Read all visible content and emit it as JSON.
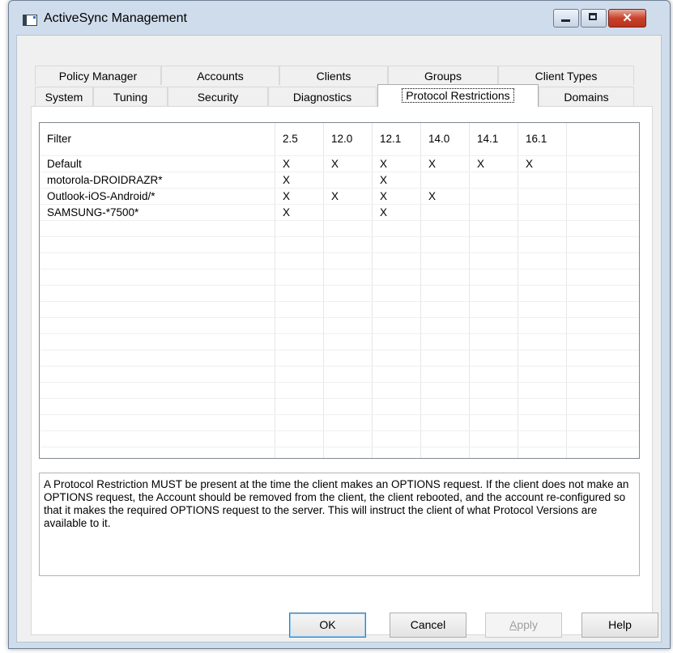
{
  "window": {
    "title": "ActiveSync Management"
  },
  "tabs": {
    "row_back": [
      "Policy Manager",
      "Accounts",
      "Clients",
      "Groups",
      "Client Types"
    ],
    "row_front": [
      "System",
      "Tuning",
      "Security",
      "Diagnostics",
      "Protocol Restrictions",
      "Domains"
    ],
    "active": "Protocol Restrictions"
  },
  "table": {
    "columns": [
      "Filter",
      "2.5",
      "12.0",
      "12.1",
      "14.0",
      "14.1",
      "16.1"
    ],
    "rows": [
      {
        "filter": "Default",
        "c25": "X",
        "c120": "X",
        "c121": "X",
        "c140": "X",
        "c141": "X",
        "c161": "X"
      },
      {
        "filter": "motorola-DROIDRAZR*",
        "c25": "X",
        "c120": "",
        "c121": "X",
        "c140": "",
        "c141": "",
        "c161": ""
      },
      {
        "filter": "Outlook-iOS-Android/*",
        "c25": "X",
        "c120": "X",
        "c121": "X",
        "c140": "X",
        "c141": "",
        "c161": ""
      },
      {
        "filter": "SAMSUNG-*7500*",
        "c25": "X",
        "c120": "",
        "c121": "X",
        "c140": "",
        "c141": "",
        "c161": ""
      }
    ]
  },
  "description": "A Protocol Restriction MUST be present at the time the client makes an OPTIONS request. If the client does not make an OPTIONS request, the Account should be removed from the client, the client rebooted, and the account re-configured so that it makes the required OPTIONS request to the server. This will instruct the client of what Protocol Versions are available to it.",
  "buttons": {
    "ok": "OK",
    "cancel": "Cancel",
    "apply_prefix": "",
    "apply_accel": "A",
    "apply_rest": "pply",
    "help": "Help"
  },
  "icons": {
    "app": "window-icon",
    "minimize": "minimize-icon",
    "maximize": "maximize-icon",
    "close": "close-icon"
  }
}
